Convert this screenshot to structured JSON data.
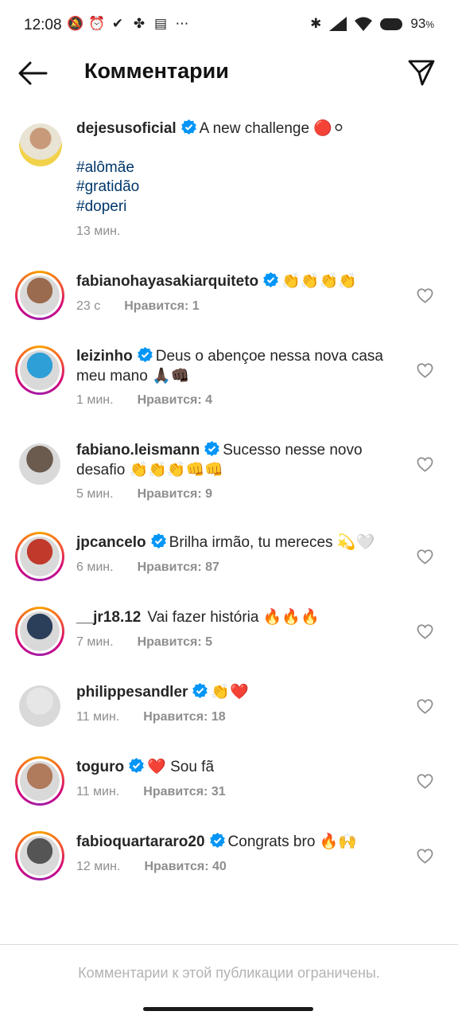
{
  "status_bar": {
    "time": "12:08",
    "battery_percent": "93",
    "battery_unit": "%",
    "icons_left": [
      "mute-bell-icon",
      "alarm-icon",
      "check-icon",
      "fan-icon",
      "calendar-icon",
      "more-dots-icon"
    ],
    "icons_right": [
      "bluetooth-icon",
      "signal-icon",
      "wifi-icon",
      "battery-icon"
    ]
  },
  "header": {
    "title": "Комментарии",
    "back_icon": "arrow-left-icon",
    "share_icon": "send-icon"
  },
  "caption": {
    "username": "dejesusoficial",
    "verified": true,
    "text": "A new challenge 🔴⚪",
    "hashtags": [
      "#alômãe",
      "#gratidão",
      "#doperi"
    ],
    "time": "13 мин."
  },
  "comments": [
    {
      "username": "fabianohayasakiarquiteto",
      "verified": true,
      "text": "👏👏👏👏",
      "time": "23 с",
      "likes": "Нравится: 1",
      "ring": true,
      "avatar_color": "#9a6b4e"
    },
    {
      "username": "leizinho",
      "verified": true,
      "text": "Deus o abençoe nessa nova casa meu mano 🙏🏿👊🏿",
      "time": "1 мин.",
      "likes": "Нравится: 4",
      "ring": true,
      "avatar_color": "#2f9fd8"
    },
    {
      "username": "fabiano.leismann",
      "verified": true,
      "text": "Sucesso nesse novo desafio 👏👏👏👊👊",
      "time": "5 мин.",
      "likes": "Нравится: 9",
      "ring": false,
      "avatar_color": "#6b5b4f"
    },
    {
      "username": "jpcancelo",
      "verified": true,
      "text": "Brilha irmão, tu mereces 💫🤍",
      "time": "6 мин.",
      "likes": "Нравится: 87",
      "ring": true,
      "avatar_color": "#c0392b"
    },
    {
      "username": "__jr18.12",
      "verified": false,
      "text": "Vai fazer história 🔥🔥🔥",
      "time": "7 мин.",
      "likes": "Нравится: 5",
      "ring": true,
      "avatar_color": "#2b3e5a"
    },
    {
      "username": "philippesandler",
      "verified": true,
      "text": "👏❤️",
      "time": "11 мин.",
      "likes": "Нравится: 18",
      "ring": false,
      "avatar_color": "#e6e6e6"
    },
    {
      "username": "toguro",
      "verified": true,
      "text": "❤️ Sou fã",
      "time": "11 мин.",
      "likes": "Нравится: 31",
      "ring": true,
      "avatar_color": "#b07a5c"
    },
    {
      "username": "fabioquartararo20",
      "verified": true,
      "text": "Congrats bro 🔥🙌",
      "time": "12 мин.",
      "likes": "Нравится: 40",
      "ring": true,
      "avatar_color": "#555555"
    }
  ],
  "footer": {
    "notice": "Комментарии к этой публикации ограничены."
  },
  "colors": {
    "hashtag": "#00376b",
    "verified_blue": "#0095f6",
    "meta_gray": "#8e8e8e"
  }
}
